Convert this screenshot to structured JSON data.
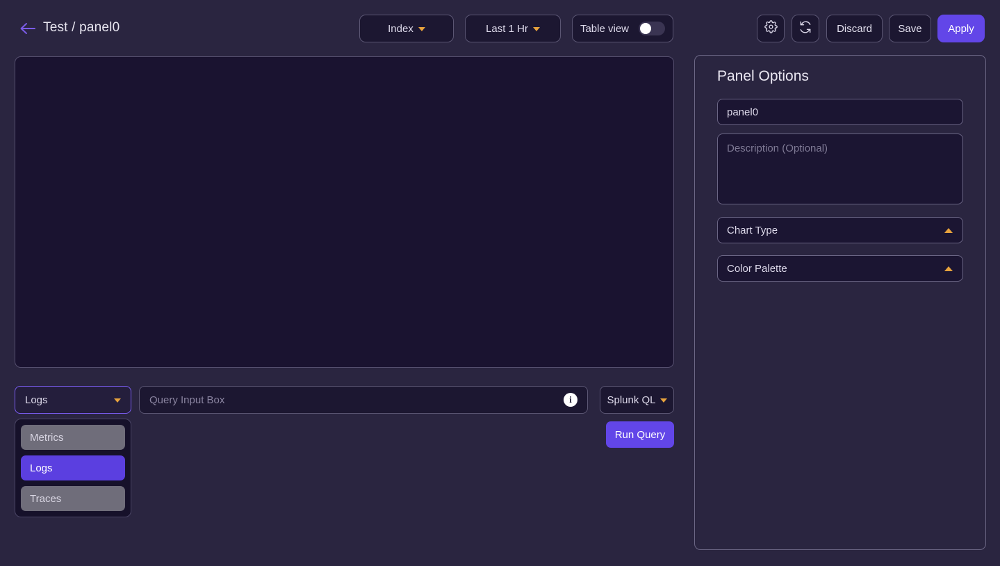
{
  "header": {
    "back_icon": "arrow-left-icon",
    "title": "Test / panel0",
    "index_label": "Index",
    "time_label": "Last 1 Hr",
    "table_view_label": "Table view",
    "table_view_on": false,
    "gear_icon": "gear-icon",
    "refresh_icon": "refresh-icon",
    "discard_label": "Discard",
    "save_label": "Save",
    "apply_label": "Apply"
  },
  "query": {
    "source_selected": "Logs",
    "source_options": [
      "Metrics",
      "Logs",
      "Traces"
    ],
    "input_placeholder": "Query Input Box",
    "input_value": "",
    "info_icon": "info-icon",
    "language_label": "Splunk QL",
    "run_label": "Run Query"
  },
  "options": {
    "title": "Panel Options",
    "name_value": "panel0",
    "description_placeholder": "Description (Optional)",
    "chart_type_label": "Chart Type",
    "color_palette_label": "Color Palette"
  },
  "colors": {
    "page_bg": "#2a2540",
    "panel_bg": "#1a1330",
    "accent_purple": "#6246e8",
    "accent_amber": "#e8a33d",
    "border": "#5b5673",
    "text": "#e8e6f0",
    "muted_text": "#8a84a0"
  }
}
